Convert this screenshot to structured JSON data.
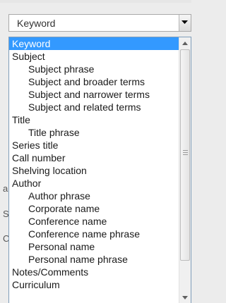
{
  "search_type_select": {
    "selected_value": "Keyword"
  },
  "options": [
    {
      "label": "Keyword",
      "indent": false,
      "selected": true
    },
    {
      "label": "Subject",
      "indent": false,
      "selected": false
    },
    {
      "label": "Subject phrase",
      "indent": true,
      "selected": false
    },
    {
      "label": "Subject and broader terms",
      "indent": true,
      "selected": false
    },
    {
      "label": "Subject and narrower terms",
      "indent": true,
      "selected": false
    },
    {
      "label": "Subject and related terms",
      "indent": true,
      "selected": false
    },
    {
      "label": "Title",
      "indent": false,
      "selected": false
    },
    {
      "label": "Title phrase",
      "indent": true,
      "selected": false
    },
    {
      "label": "Series title",
      "indent": false,
      "selected": false
    },
    {
      "label": "Call number",
      "indent": false,
      "selected": false
    },
    {
      "label": "Shelving location",
      "indent": false,
      "selected": false
    },
    {
      "label": "Author",
      "indent": false,
      "selected": false
    },
    {
      "label": "Author phrase",
      "indent": true,
      "selected": false
    },
    {
      "label": "Corporate name",
      "indent": true,
      "selected": false
    },
    {
      "label": "Conference name",
      "indent": true,
      "selected": false
    },
    {
      "label": "Conference name phrase",
      "indent": true,
      "selected": false
    },
    {
      "label": "Personal name",
      "indent": true,
      "selected": false
    },
    {
      "label": "Personal name phrase",
      "indent": true,
      "selected": false
    },
    {
      "label": "Notes/Comments",
      "indent": false,
      "selected": false
    },
    {
      "label": "Curriculum",
      "indent": false,
      "selected": false
    }
  ],
  "scroll": {
    "position_fraction": 0.0
  },
  "colors": {
    "highlight": "#3399ff",
    "highlight_text": "#ffffff",
    "border": "#7f9db9"
  },
  "background_fragments": {
    "a": "a",
    "s": "S",
    "c": "C"
  }
}
